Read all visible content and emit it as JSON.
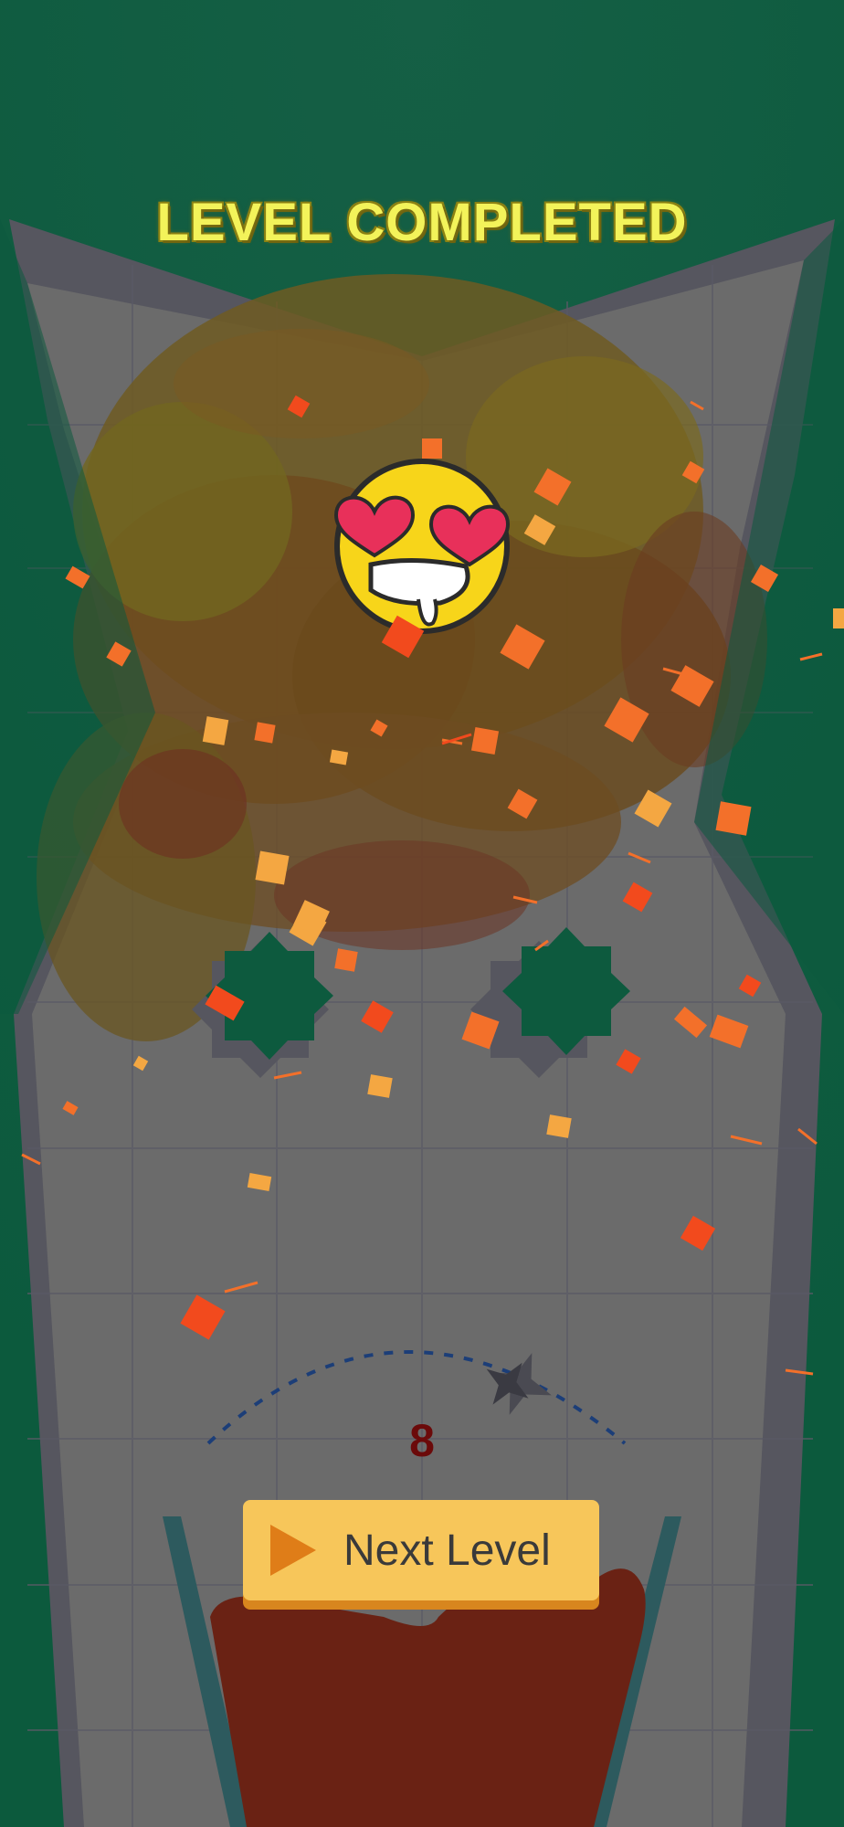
{
  "screen": {
    "title": "LEVEL COMPLETED",
    "shots_counter": "8",
    "next_button": {
      "label": "Next Level",
      "icon": "play-icon"
    }
  },
  "emoji": {
    "icon": "heart-eyes-face-icon"
  },
  "colors": {
    "background": "#0d5a3e",
    "board": "#6b6b6b",
    "title": "#f3f35a",
    "button": "#f7c65a",
    "button_icon": "#df7d18",
    "cup_liquid": "#6a2214",
    "trajectory": "#1c3e78",
    "confetti_orange": "#f3702a",
    "confetti_red": "#f24a1d",
    "confetti_gold": "#f4a742"
  }
}
